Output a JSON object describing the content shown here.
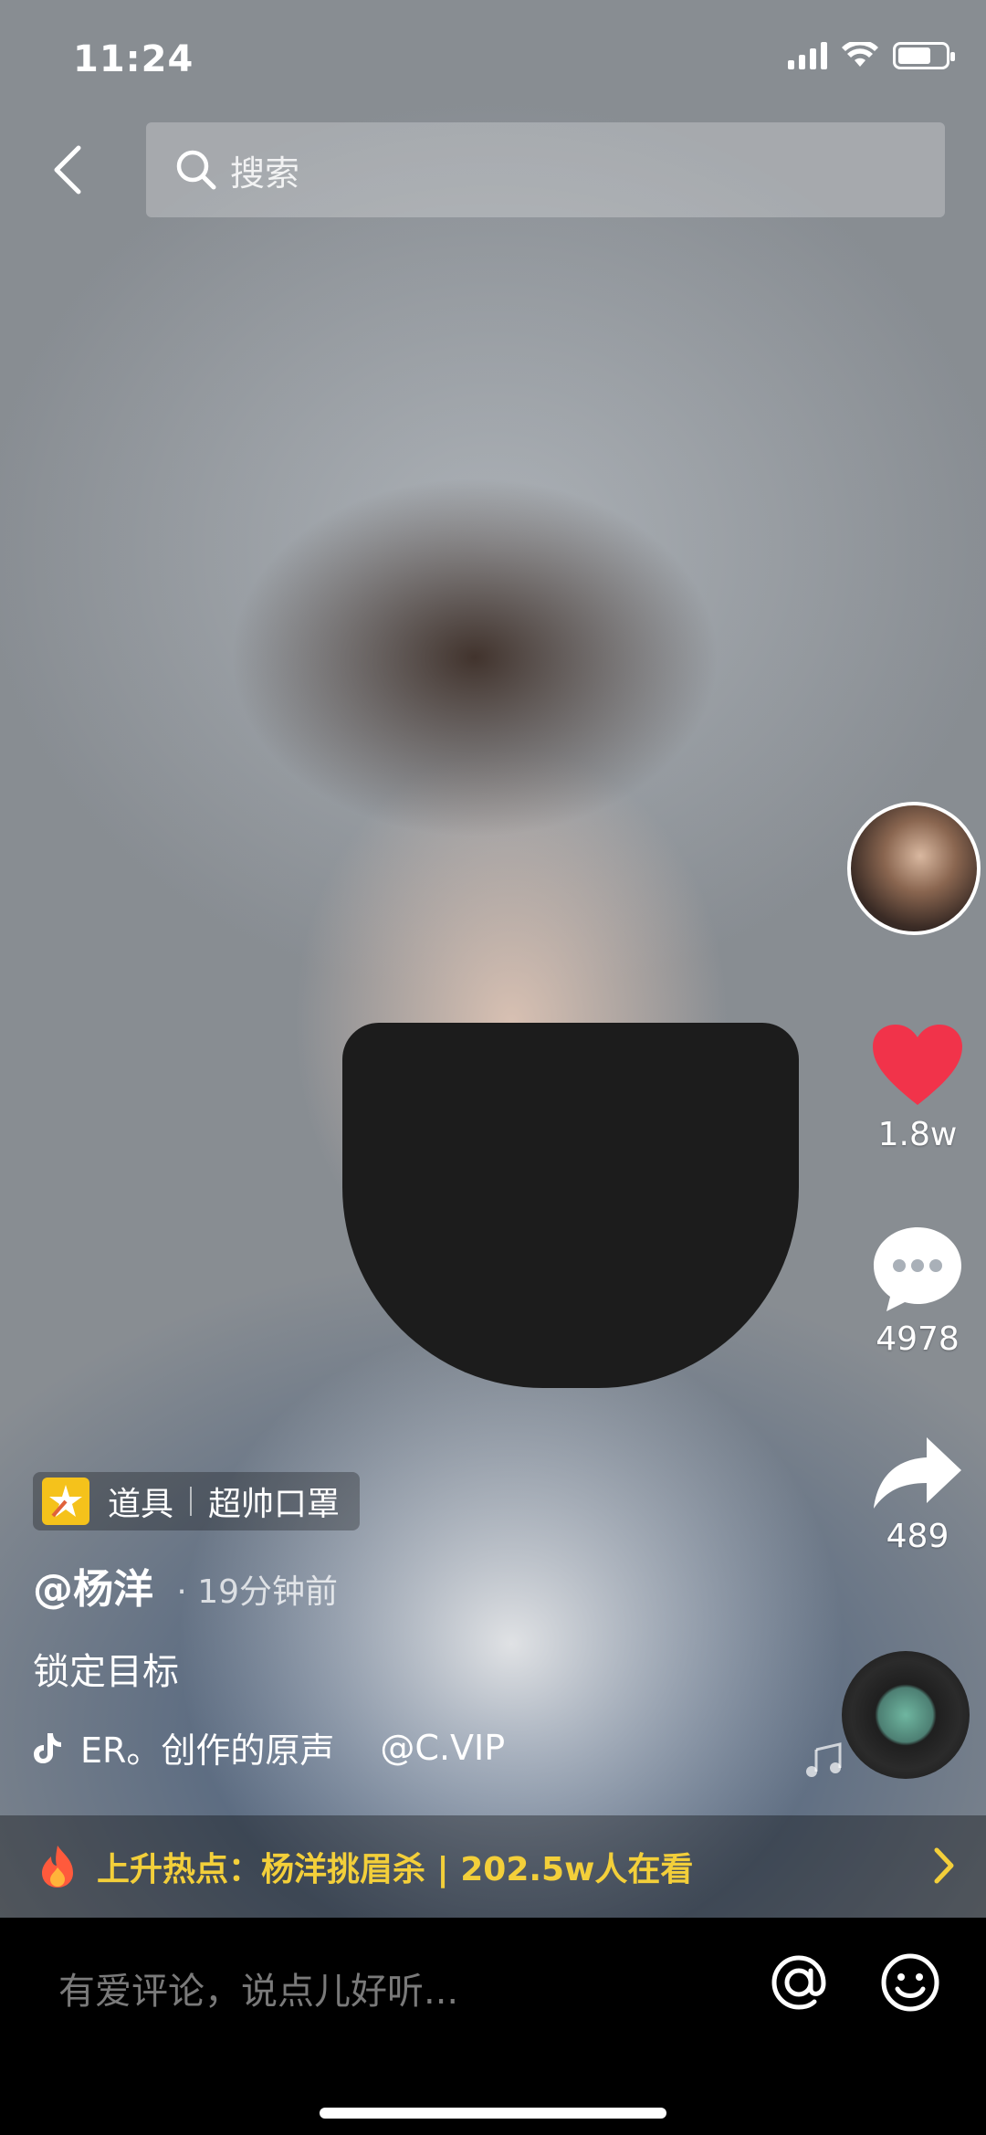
{
  "status": {
    "time": "11:24",
    "battery_level": 0.7
  },
  "search": {
    "placeholder": "搜索"
  },
  "rail": {
    "likes": "1.8w",
    "comments": "4978",
    "shares": "489"
  },
  "video_info": {
    "prop_label": "道具",
    "prop_name": "超帅口罩",
    "author": "@杨洋",
    "time_ago": "· 19分钟前",
    "caption": "锁定目标",
    "music_text": "ER。创作的原声",
    "music_mention": "@C.VIP"
  },
  "hot": {
    "text": "上升热点：杨洋挑眉杀 | 202.5w人在看"
  },
  "comment_bar": {
    "placeholder": "有爱评论，说点儿好听..."
  },
  "colors": {
    "like": "#f1334a",
    "hot_text": "#f3cf3a",
    "prop_icon": "#f5c21b"
  }
}
